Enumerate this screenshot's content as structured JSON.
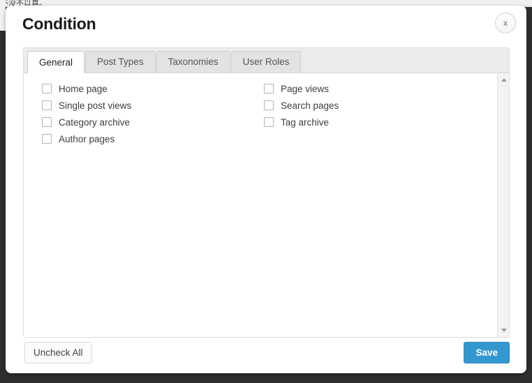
{
  "background": {
    "overlay_color": "#2e2e2e",
    "page_strip_text": "不没不以真。"
  },
  "modal": {
    "title": "Condition",
    "close_label": "x",
    "close_icon": "close-x-icon",
    "accent_color": "#3498cf"
  },
  "tabs": [
    {
      "label": "General",
      "active": true
    },
    {
      "label": "Post Types",
      "active": false
    },
    {
      "label": "Taxonomies",
      "active": false
    },
    {
      "label": "User Roles",
      "active": false
    }
  ],
  "content": {
    "left_column": [
      {
        "label": "Home page",
        "checked": false
      },
      {
        "label": "Single post views",
        "checked": false
      },
      {
        "label": "Category archive",
        "checked": false
      },
      {
        "label": "Author pages",
        "checked": false
      }
    ],
    "right_column": [
      {
        "label": "Page views",
        "checked": false
      },
      {
        "label": "Search pages",
        "checked": false
      },
      {
        "label": "Tag archive",
        "checked": false
      }
    ]
  },
  "scrollbar": {
    "up_icon": "triangle-up-icon",
    "down_icon": "triangle-down-icon"
  },
  "footer": {
    "uncheck_all_label": "Uncheck All",
    "save_label": "Save"
  }
}
